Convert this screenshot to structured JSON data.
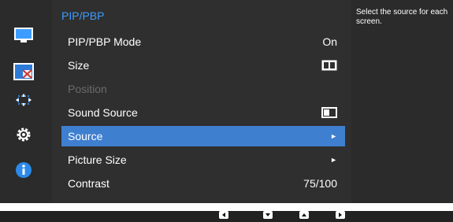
{
  "panel": {
    "title": "PIP/PBP",
    "items": [
      {
        "label": "PIP/PBP Mode",
        "value": "On",
        "enabled": true,
        "selected": false
      },
      {
        "label": "Size",
        "value": "",
        "value_icon": "pbp-size-icon",
        "enabled": true,
        "selected": false
      },
      {
        "label": "Position",
        "value": "",
        "enabled": false,
        "selected": false
      },
      {
        "label": "Sound Source",
        "value": "",
        "value_icon": "screen-left-icon",
        "enabled": true,
        "selected": false
      },
      {
        "label": "Source",
        "value": "►",
        "enabled": true,
        "selected": true
      },
      {
        "label": "Picture Size",
        "value": "►",
        "enabled": true,
        "selected": false
      },
      {
        "label": "Contrast",
        "value": "75/100",
        "enabled": true,
        "selected": false
      }
    ]
  },
  "help": {
    "text": "Select the source for each screen."
  },
  "rail_icons": [
    "monitor-icon",
    "pip-icon",
    "move-icon",
    "gear-icon",
    "info-icon"
  ],
  "nav_icons": [
    "left-arrow-icon",
    "down-arrow-icon",
    "up-arrow-icon",
    "right-arrow-icon"
  ],
  "colors": {
    "accent": "#3c9cff",
    "selection": "#3f7fd0",
    "background": "#2b2b2b"
  }
}
